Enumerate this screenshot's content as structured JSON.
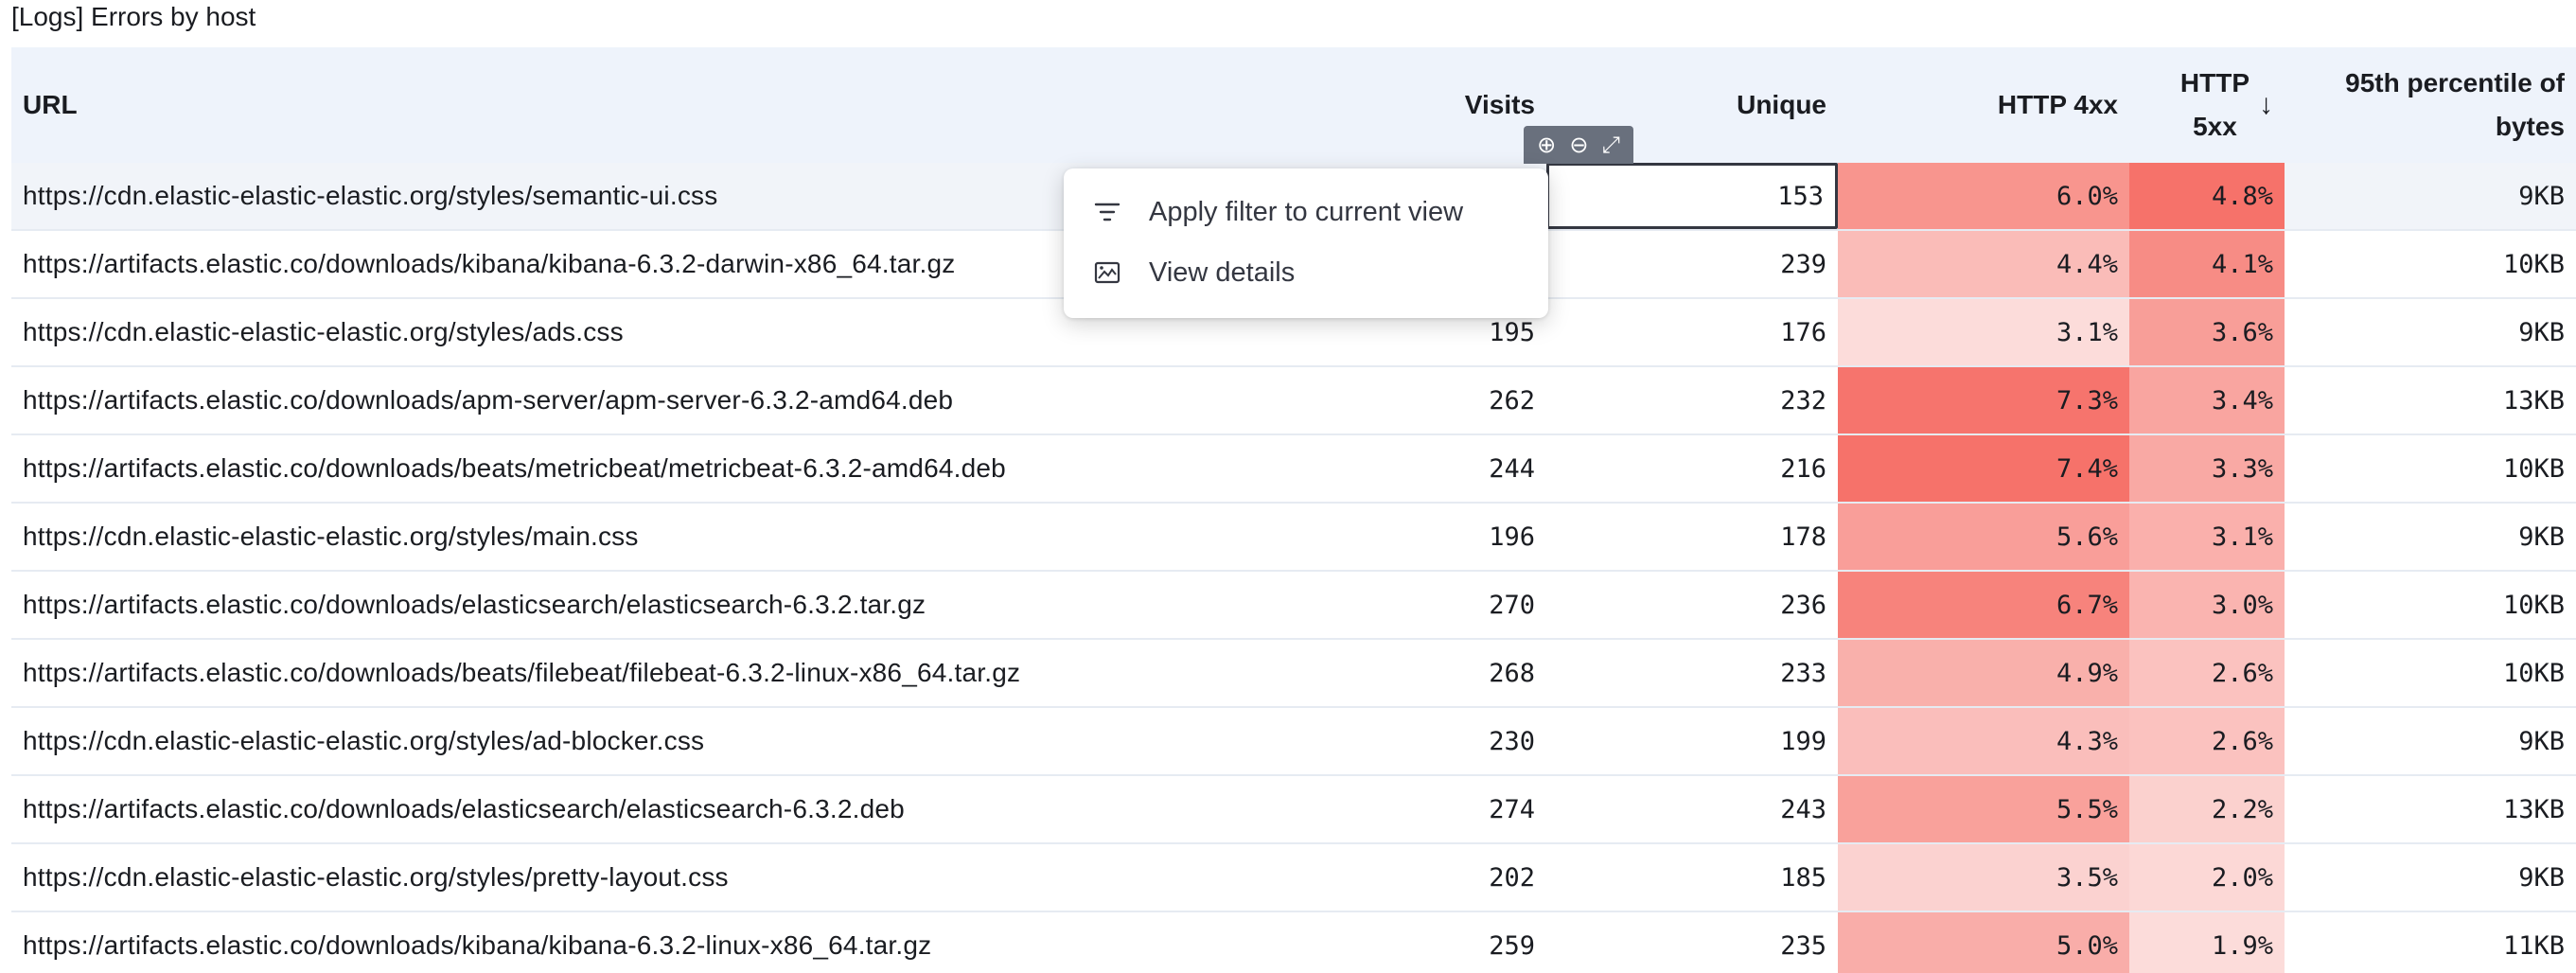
{
  "panel": {
    "title": "[Logs] Errors by host"
  },
  "columns": {
    "url": "URL",
    "visits": "Visits",
    "unique": "Unique",
    "http4xx": "HTTP 4xx",
    "http5xx_line1": "HTTP",
    "http5xx_line2": "5xx",
    "bytes_line1": "95th percentile of",
    "bytes_line2": "bytes"
  },
  "sort": {
    "column": "http5xx",
    "direction": "descending",
    "icon": "arrow-down-icon"
  },
  "cell_actions": {
    "filter_in_icon": "plus-circle-icon",
    "filter_out_icon": "minus-circle-icon",
    "expand_icon": "expand-icon"
  },
  "popover": {
    "items": [
      {
        "label": "Apply filter to current view",
        "icon": "filter-icon"
      },
      {
        "label": "View details",
        "icon": "inspect-icon"
      }
    ]
  },
  "colors": {
    "header_bg": "#eef3fb",
    "focus_border": "#343741",
    "scale_lightest": "#fcdcda",
    "scale_darkest": "#f6726a"
  },
  "rows": [
    {
      "url": "https://cdn.elastic-elastic-elastic.org/styles/semantic-ui.css",
      "visits": "",
      "unique": "153",
      "http4xx": "6.0%",
      "http5xx": "4.8%",
      "bytes": "9KB"
    },
    {
      "url": "https://artifacts.elastic.co/downloads/kibana/kibana-6.3.2-darwin-x86_64.tar.gz",
      "visits": "",
      "unique": "239",
      "http4xx": "4.4%",
      "http5xx": "4.1%",
      "bytes": "10KB"
    },
    {
      "url": "https://cdn.elastic-elastic-elastic.org/styles/ads.css",
      "visits": "195",
      "unique": "176",
      "http4xx": "3.1%",
      "http5xx": "3.6%",
      "bytes": "9KB"
    },
    {
      "url": "https://artifacts.elastic.co/downloads/apm-server/apm-server-6.3.2-amd64.deb",
      "visits": "262",
      "unique": "232",
      "http4xx": "7.3%",
      "http5xx": "3.4%",
      "bytes": "13KB"
    },
    {
      "url": "https://artifacts.elastic.co/downloads/beats/metricbeat/metricbeat-6.3.2-amd64.deb",
      "visits": "244",
      "unique": "216",
      "http4xx": "7.4%",
      "http5xx": "3.3%",
      "bytes": "10KB"
    },
    {
      "url": "https://cdn.elastic-elastic-elastic.org/styles/main.css",
      "visits": "196",
      "unique": "178",
      "http4xx": "5.6%",
      "http5xx": "3.1%",
      "bytes": "9KB"
    },
    {
      "url": "https://artifacts.elastic.co/downloads/elasticsearch/elasticsearch-6.3.2.tar.gz",
      "visits": "270",
      "unique": "236",
      "http4xx": "6.7%",
      "http5xx": "3.0%",
      "bytes": "10KB"
    },
    {
      "url": "https://artifacts.elastic.co/downloads/beats/filebeat/filebeat-6.3.2-linux-x86_64.tar.gz",
      "visits": "268",
      "unique": "233",
      "http4xx": "4.9%",
      "http5xx": "2.6%",
      "bytes": "10KB"
    },
    {
      "url": "https://cdn.elastic-elastic-elastic.org/styles/ad-blocker.css",
      "visits": "230",
      "unique": "199",
      "http4xx": "4.3%",
      "http5xx": "2.6%",
      "bytes": "9KB"
    },
    {
      "url": "https://artifacts.elastic.co/downloads/elasticsearch/elasticsearch-6.3.2.deb",
      "visits": "274",
      "unique": "243",
      "http4xx": "5.5%",
      "http5xx": "2.2%",
      "bytes": "13KB"
    },
    {
      "url": "https://cdn.elastic-elastic-elastic.org/styles/pretty-layout.css",
      "visits": "202",
      "unique": "185",
      "http4xx": "3.5%",
      "http5xx": "2.0%",
      "bytes": "9KB"
    },
    {
      "url": "https://artifacts.elastic.co/downloads/kibana/kibana-6.3.2-linux-x86_64.tar.gz",
      "visits": "259",
      "unique": "235",
      "http4xx": "5.0%",
      "http5xx": "1.9%",
      "bytes": "11KB"
    }
  ]
}
